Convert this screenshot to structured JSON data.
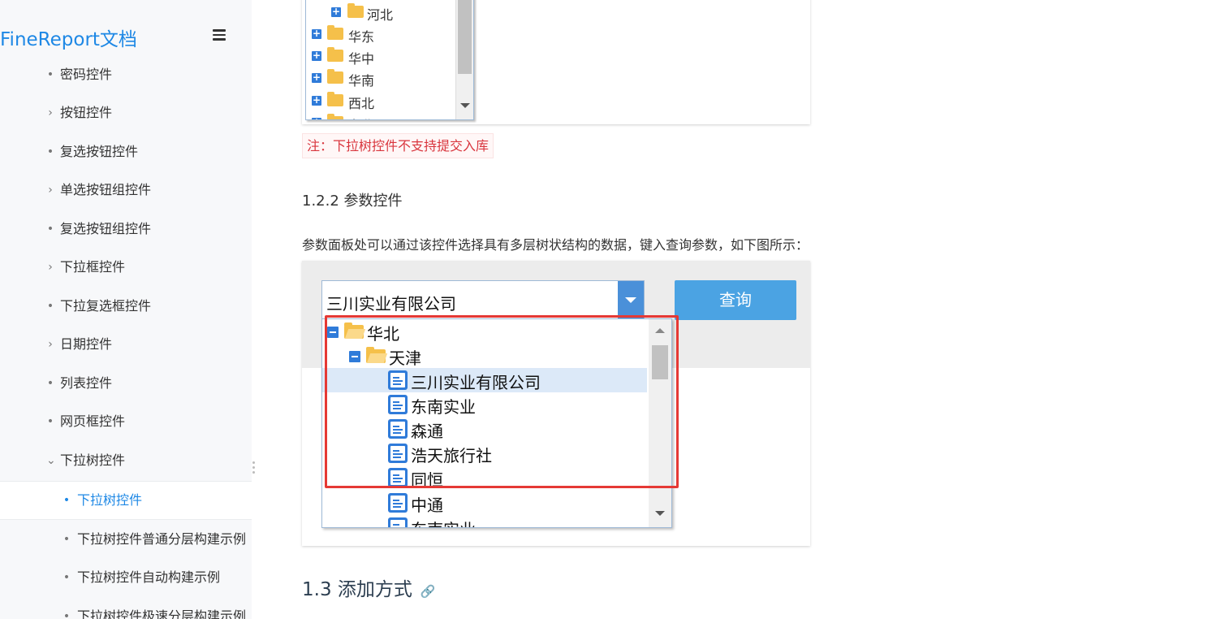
{
  "sidebar": {
    "brand": "FineReport文档",
    "menu_icon": "hamburger-menu-icon",
    "items": [
      {
        "label": "密码控件",
        "marker": "•"
      },
      {
        "label": "按钮控件",
        "marker": "›"
      },
      {
        "label": "复选按钮控件",
        "marker": "•"
      },
      {
        "label": "单选按钮组控件",
        "marker": "›"
      },
      {
        "label": "复选按钮组控件",
        "marker": "•"
      },
      {
        "label": "下拉框控件",
        "marker": "›"
      },
      {
        "label": "下拉复选框控件",
        "marker": "•"
      },
      {
        "label": "日期控件",
        "marker": "›"
      },
      {
        "label": "列表控件",
        "marker": "•"
      },
      {
        "label": "网页框控件",
        "marker": "•"
      },
      {
        "label": "下拉树控件",
        "marker": "⌄"
      },
      {
        "label": "下拉树控件",
        "marker": "•"
      },
      {
        "label": "下拉树控件普通分层构建示例",
        "marker": "•"
      },
      {
        "label": "下拉树控件自动构建示例",
        "marker": "•"
      },
      {
        "label": "下拉树控件极速分层构建示例",
        "marker": "•"
      }
    ]
  },
  "figure1": {
    "tree_items": [
      "河北",
      "华东",
      "华中",
      "华南",
      "西北",
      "东北"
    ]
  },
  "note": "注：下拉树控件不支持提交入库",
  "section_122": {
    "heading": "1.2.2 参数控件",
    "paragraph": "参数面板处可以通过该控件选择具有多层树状结构的数据，键入查询参数，如下图所示："
  },
  "figure2": {
    "combo_value": "三川实业有限公司",
    "query_button": "查询",
    "tree": {
      "group": "华北",
      "subgroup": "天津",
      "leaves": [
        "三川实业有限公司",
        "东南实业",
        "森通",
        "浩天旅行社",
        "同恒",
        "中通",
        "东南实业"
      ]
    },
    "highlight_color": "#e53935"
  },
  "section_13": {
    "heading": "1.3 添加方式",
    "anchor_icon": "link-icon"
  },
  "colors": {
    "accent": "#1e88e5",
    "note_text": "#d9363e",
    "button": "#4ba3e3"
  }
}
